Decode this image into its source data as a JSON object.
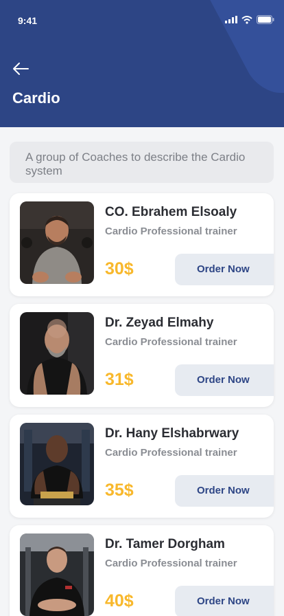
{
  "status_bar": {
    "time": "9:41"
  },
  "header": {
    "title": "Cardio"
  },
  "intro": {
    "text": "A group of Coaches to describe the Cardio system"
  },
  "colors": {
    "header": "#2d4585",
    "price": "#f8b82c",
    "button_bg": "#e7ebf1"
  },
  "trainers": [
    {
      "name": "CO. Ebrahem Elsoaly",
      "role": "Cardio Professional trainer",
      "price": "30$",
      "action": "Order Now"
    },
    {
      "name": "Dr. Zeyad Elmahy",
      "role": "Cardio Professional trainer",
      "price": "31$",
      "action": "Order Now"
    },
    {
      "name": "Dr. Hany Elshabrwary",
      "role": "Cardio Professional trainer",
      "price": "35$",
      "action": "Order Now"
    },
    {
      "name": "Dr. Tamer Dorgham",
      "role": "Cardio Professional trainer",
      "price": "40$",
      "action": "Order Now"
    }
  ]
}
